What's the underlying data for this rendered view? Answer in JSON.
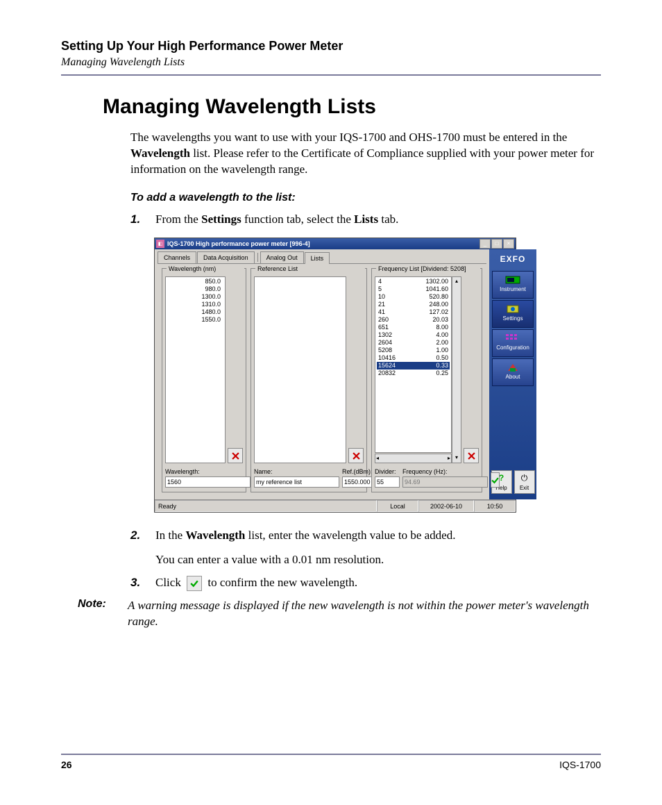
{
  "header": {
    "chapter": "Setting Up Your High Performance Power Meter",
    "section": "Managing Wavelength Lists"
  },
  "heading": "Managing Wavelength Lists",
  "intro": {
    "p1a": "The wavelengths you want to use with your IQS-1700 and OHS-1700 must be entered in the ",
    "bold1": "Wavelength",
    "p1b": " list. Please refer to the Certificate of Compliance supplied with your power meter for information on the wavelength range."
  },
  "procedure": {
    "subhead": "To add a wavelength to the list:",
    "steps": [
      {
        "num": "1.",
        "t1": "From the ",
        "b1": "Settings",
        "t2": " function tab, select the ",
        "b2": "Lists",
        "t3": " tab."
      },
      {
        "num": "2.",
        "t1": "In the ",
        "b1": "Wavelength",
        "t2": " list, enter the wavelength value to be added.",
        "t3": "You can enter a value with a 0.01 nm resolution."
      },
      {
        "num": "3.",
        "t1": "Click ",
        "t2": " to confirm the new wavelength."
      }
    ]
  },
  "note": {
    "label": "Note:",
    "text": "A warning message is displayed if the new wavelength is not within the power meter's wavelength range."
  },
  "footer": {
    "page": "26",
    "model": "IQS-1700"
  },
  "app": {
    "title": "IQS-1700 High performance power meter [996-4]",
    "tabs": [
      "Channels",
      "Data Acquisition",
      "Analog Out",
      "Lists"
    ],
    "wavelength": {
      "title": "Wavelength (nm)",
      "items": [
        "850.0",
        "980.0",
        "1300.0",
        "1310.0",
        "1480.0",
        "1550.0"
      ],
      "input_label": "Wavelength:",
      "input_value": "1560"
    },
    "reference": {
      "title": "Reference List",
      "name_label": "Name:",
      "name_value": "my reference list",
      "ref_label": "Ref.(dBm):",
      "ref_value": "1550.000"
    },
    "frequency": {
      "title": "Frequency List [Dividend: 5208]",
      "rows": [
        [
          "4",
          "1302.00"
        ],
        [
          "5",
          "1041.60"
        ],
        [
          "10",
          "520.80"
        ],
        [
          "21",
          "248.00"
        ],
        [
          "41",
          "127.02"
        ],
        [
          "260",
          "20.03"
        ],
        [
          "651",
          "8.00"
        ],
        [
          "1302",
          "4.00"
        ],
        [
          "2604",
          "2.00"
        ],
        [
          "5208",
          "1.00"
        ],
        [
          "10416",
          "0.50"
        ],
        [
          "15624",
          "0.33"
        ],
        [
          "20832",
          "0.25"
        ]
      ],
      "selected_index": 11,
      "divider_label": "Divider:",
      "divider_value": "55",
      "freq_label": "Frequency (Hz):",
      "freq_value": "94.69"
    },
    "sidebar": {
      "logo": "EXFO",
      "items": [
        "Instrument",
        "Settings",
        "Configuration",
        "About"
      ],
      "help": "Help",
      "exit": "Exit"
    },
    "status": {
      "ready": "Ready",
      "mode": "Local",
      "date": "2002-06-10",
      "time": "10:50"
    }
  }
}
